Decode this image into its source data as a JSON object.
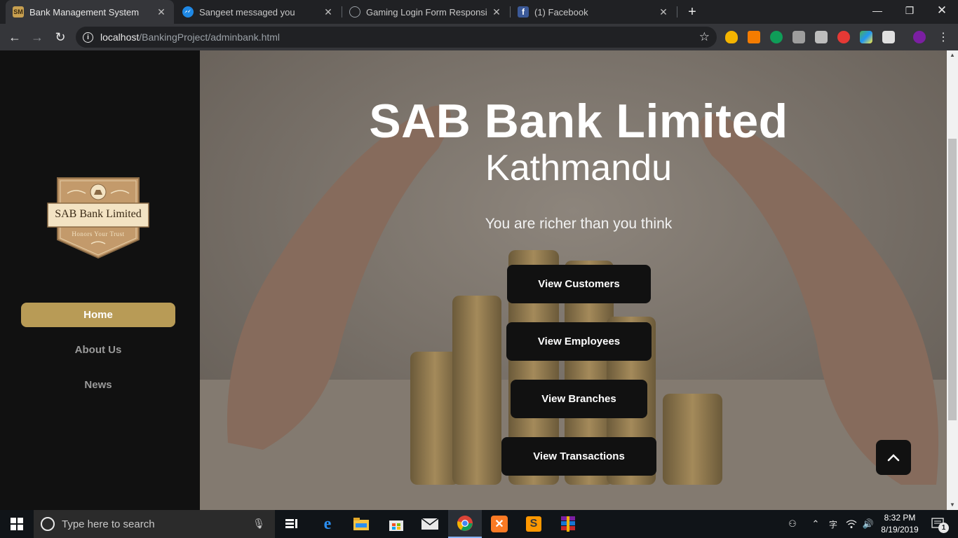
{
  "browser": {
    "tabs": [
      {
        "title": "Bank Management System",
        "favicon": "SM",
        "active": true
      },
      {
        "title": "Sangeet messaged you",
        "favicon": "messenger-icon",
        "active": false
      },
      {
        "title": "Gaming Login Form Responsive W",
        "favicon": "globe-icon",
        "active": false
      },
      {
        "title": "(1) Facebook",
        "favicon": "facebook-icon",
        "active": false
      }
    ],
    "url_host": "localhost",
    "url_path": "/BankingProject/adminbank.html"
  },
  "sidebar": {
    "logo": {
      "name": "SAB Bank Limited",
      "slogan": "Honors Your Trust"
    },
    "nav": [
      {
        "label": "Home",
        "active": true
      },
      {
        "label": "About Us",
        "active": false
      },
      {
        "label": "News",
        "active": false
      }
    ]
  },
  "hero": {
    "title": "SAB Bank Limited",
    "subtitle": "Kathmandu",
    "tagline": "You are richer than you think",
    "buttons": [
      {
        "label": "View Customers"
      },
      {
        "label": "View Employees"
      },
      {
        "label": "View Branches"
      },
      {
        "label": "View Transactions"
      }
    ]
  },
  "taskbar": {
    "search_placeholder": "Type here to search",
    "time": "8:32 PM",
    "date": "8/19/2019",
    "notifications": "1"
  },
  "colors": {
    "accent": "#b89b56",
    "sidebar_bg": "#111111",
    "button_bg": "#111111"
  }
}
